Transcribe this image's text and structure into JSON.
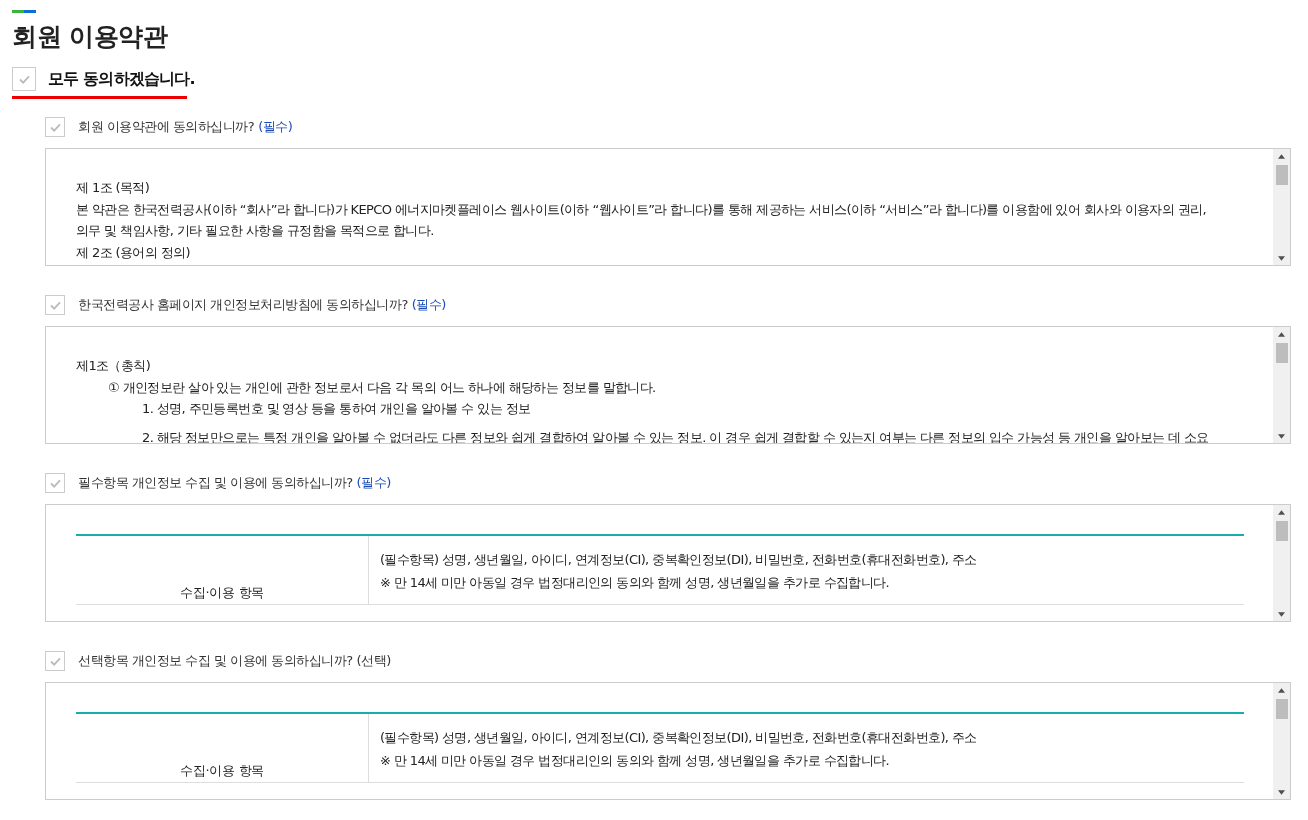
{
  "page": {
    "title": "회원 이용약관"
  },
  "agree_all": {
    "label": "모두 동의하겠습니다.",
    "checked": true
  },
  "agreements": [
    {
      "label": "회원 이용약관에 동의하십니까?",
      "tag": "(필수)",
      "kind": "required",
      "checked": true,
      "content": {
        "kind": "text",
        "lines": [
          {
            "text": "제 1조 (목적)"
          },
          {
            "text": "본 약관은 한국전력공사(이하 “회사”라 합니다)가 KEPCO 에너지마켓플레이스 웹사이트(이하 “웹사이트”라 합니다)를 통해 제공하는 서비스(이하 “서비스”라 합니다)를 이용함에 있어 회사와 이용자의 권리,"
          },
          {
            "text": "의무 및 책임사항, 기타 필요한 사항을 규정함을 목적으로 합니다."
          },
          {
            "text": "제 2조 (용어의 정의)"
          }
        ]
      }
    },
    {
      "label": "한국전력공사 홈페이지 개인정보처리방침에 동의하십니까?",
      "tag": "(필수)",
      "kind": "required",
      "checked": true,
      "content": {
        "kind": "text",
        "lines": [
          {
            "text": "제1조（총칙)",
            "children": [
              {
                "text": "① 개인정보란 살아 있는 개인에 관한 정보로서 다음 각 목의 어느 하나에 해당하는 정보를 말합니다.",
                "children": [
                  {
                    "text": "1. 성명, 주민등록번호 및 영상 등을 통하여 개인을 알아볼 수 있는 정보"
                  },
                  {
                    "text": "2. 해당 정보만으로는 특정 개인을 알아볼 수 없더라도 다른 정보와 쉽게 결합하여 알아볼 수 있는 정보. 이 경우 쉽게 결합할 수 있는지 여부는 다른 정보의 입수 가능성 등 개인을 알아보는 데 소요"
                  }
                ]
              }
            ]
          }
        ]
      }
    },
    {
      "label": "필수항목 개인정보 수집 및 이용에 동의하십니까?",
      "tag": "(필수)",
      "kind": "required",
      "checked": true,
      "content": {
        "kind": "table",
        "rows": [
          {
            "header": "수집·이용 항목",
            "lines": [
              "(필수항목) 성명, 생년월일, 아이디, 연계정보(CI), 중복확인정보(DI), 비밀번호, 전화번호(휴대전화번호), 주소",
              "※ 만 14세 미만 아동일 경우 법정대리인의 동의와 함께 성명, 생년월일을 추가로 수집합니다."
            ]
          }
        ]
      }
    },
    {
      "label": "선택항목 개인정보 수집 및 이용에 동의하십니까?",
      "tag": "(선택)",
      "kind": "optional",
      "checked": true,
      "content": {
        "kind": "table",
        "rows": [
          {
            "header": "수집·이용 항목",
            "lines": [
              "(필수항목) 성명, 생년월일, 아이디, 연계정보(CI), 중복확인정보(DI), 비밀번호, 전화번호(휴대전화번호), 주소",
              "※ 만 14세 미만 아동일 경우 법정대리인의 동의와 함께 성명, 생년월일을 추가로 수집합니다."
            ]
          }
        ]
      }
    }
  ]
}
